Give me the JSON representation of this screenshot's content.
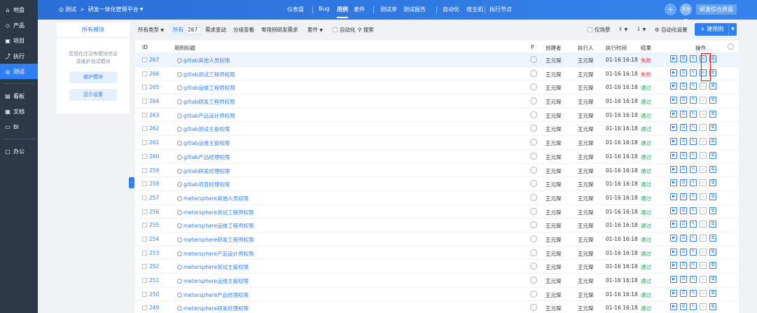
{
  "nav": {
    "items": [
      {
        "icon": "⌂",
        "label": "地盘",
        "active": false
      },
      {
        "icon": "◇",
        "label": "产品",
        "active": false
      },
      {
        "icon": "▣",
        "label": "项目",
        "active": false
      },
      {
        "icon": "⤴",
        "label": "执行",
        "active": false
      },
      {
        "icon": "◎",
        "label": "测试",
        "active": true
      }
    ],
    "items2": [
      {
        "icon": "▤",
        "label": "看板"
      },
      {
        "icon": "▦",
        "label": "文档"
      },
      {
        "icon": "▭",
        "label": "BI"
      }
    ],
    "items3": [
      {
        "icon": "▢",
        "label": "办公"
      }
    ]
  },
  "header": {
    "crumb_root": "测试",
    "crumb_sep": ">",
    "crumb_current": "研发一体化管理平台",
    "menu": [
      "仪表盘",
      "Bug",
      "用例",
      "套件",
      "测试单",
      "测试报告",
      "自动化",
      "宿主机",
      "执行节点"
    ],
    "active_menu": "用例",
    "avatar": "王元琛",
    "hq_button": "研发综合界面"
  },
  "module_panel": {
    "title": "所有模块",
    "tip_line1": "您现在还没有模块信息",
    "tip_line2": "请维护测试模块",
    "maintain_btn": "维护模块",
    "display_btn": "显示设置"
  },
  "toolbar": {
    "type_filter": "所有类型",
    "all_label": "所有",
    "all_count": "267",
    "need_change": "需求变动",
    "group_view": "分组查看",
    "zero_case": "零用例研发需求",
    "suite": "套件",
    "automation_chk": "自动化",
    "search": "搜索",
    "scenario_chk": "仅场景",
    "automation_settings": "自动化设置",
    "new_case": "建用例"
  },
  "table": {
    "headers": {
      "id": "ID",
      "title": "用例标题",
      "p": "P",
      "creator": "创建者",
      "executor": "执行人",
      "time": "执行时间",
      "result": "结果",
      "ops": "操作"
    },
    "rows": [
      {
        "id": "267",
        "title": "gitlab其他人员权限",
        "creator": "王元琛",
        "executor": "王元琛",
        "time": "01-16 16:18",
        "result": "失败",
        "status": "fail"
      },
      {
        "id": "266",
        "title": "gitlab测试工程师权限",
        "creator": "王元琛",
        "executor": "王元琛",
        "time": "01-16 16:18",
        "result": "失败",
        "status": "fail"
      },
      {
        "id": "265",
        "title": "gitlab运维工程师权限",
        "creator": "王元琛",
        "executor": "王元琛",
        "time": "01-16 16:18",
        "result": "通过",
        "status": "pass"
      },
      {
        "id": "264",
        "title": "gitlab研发工程师权限",
        "creator": "王元琛",
        "executor": "王元琛",
        "time": "01-16 16:18",
        "result": "通过",
        "status": "pass"
      },
      {
        "id": "263",
        "title": "gitlab产品设计师权限",
        "creator": "王元琛",
        "executor": "王元琛",
        "time": "01-16 16:18",
        "result": "通过",
        "status": "pass"
      },
      {
        "id": "262",
        "title": "gitlab测试主管权限",
        "creator": "王元琛",
        "executor": "王元琛",
        "time": "01-16 16:18",
        "result": "通过",
        "status": "pass"
      },
      {
        "id": "261",
        "title": "gitlab运维主管权限",
        "creator": "王元琛",
        "executor": "王元琛",
        "time": "01-16 16:18",
        "result": "通过",
        "status": "pass"
      },
      {
        "id": "260",
        "title": "gitlab产品经理权限",
        "creator": "王元琛",
        "executor": "王元琛",
        "time": "01-16 16:18",
        "result": "通过",
        "status": "pass"
      },
      {
        "id": "259",
        "title": "gitlab研发经理权限",
        "creator": "王元琛",
        "executor": "王元琛",
        "time": "01-16 16:18",
        "result": "通过",
        "status": "pass"
      },
      {
        "id": "258",
        "title": "gitlab项目经理权限",
        "creator": "王元琛",
        "executor": "王元琛",
        "time": "01-16 16:18",
        "result": "通过",
        "status": "pass"
      },
      {
        "id": "257",
        "title": "metersphere其他人员权限",
        "creator": "王元琛",
        "executor": "王元琛",
        "time": "01-16 16:18",
        "result": "通过",
        "status": "pass"
      },
      {
        "id": "256",
        "title": "metersphere测试工程师权限",
        "creator": "王元琛",
        "executor": "王元琛",
        "time": "01-16 16:18",
        "result": "通过",
        "status": "pass"
      },
      {
        "id": "255",
        "title": "metersphere运维工程师权限",
        "creator": "王元琛",
        "executor": "王元琛",
        "time": "01-16 16:18",
        "result": "通过",
        "status": "pass"
      },
      {
        "id": "254",
        "title": "metersphere研发工程师权限",
        "creator": "王元琛",
        "executor": "王元琛",
        "time": "01-16 16:18",
        "result": "通过",
        "status": "pass"
      },
      {
        "id": "253",
        "title": "metersphere产品设计师权限",
        "creator": "王元琛",
        "executor": "王元琛",
        "time": "01-16 16:18",
        "result": "通过",
        "status": "pass"
      },
      {
        "id": "252",
        "title": "metersphere测试主管权限",
        "creator": "王元琛",
        "executor": "王元琛",
        "time": "01-16 16:18",
        "result": "通过",
        "status": "pass"
      },
      {
        "id": "251",
        "title": "metersphere运维主管权限",
        "creator": "王元琛",
        "executor": "王元琛",
        "time": "01-16 16:18",
        "result": "通过",
        "status": "pass"
      },
      {
        "id": "250",
        "title": "metersphere产品经理权限",
        "creator": "王元琛",
        "executor": "王元琛",
        "time": "01-16 16:18",
        "result": "通过",
        "status": "pass"
      },
      {
        "id": "249",
        "title": "metersphere研发经理权限",
        "creator": "王元琛",
        "executor": "王元琛",
        "time": "01-16 16:18",
        "result": "通过",
        "status": "pass"
      }
    ]
  },
  "colors": {
    "accent": "#2e7ff1",
    "nav_bg": "#2b3848",
    "fail": "#e53333",
    "pass": "#11a651"
  }
}
